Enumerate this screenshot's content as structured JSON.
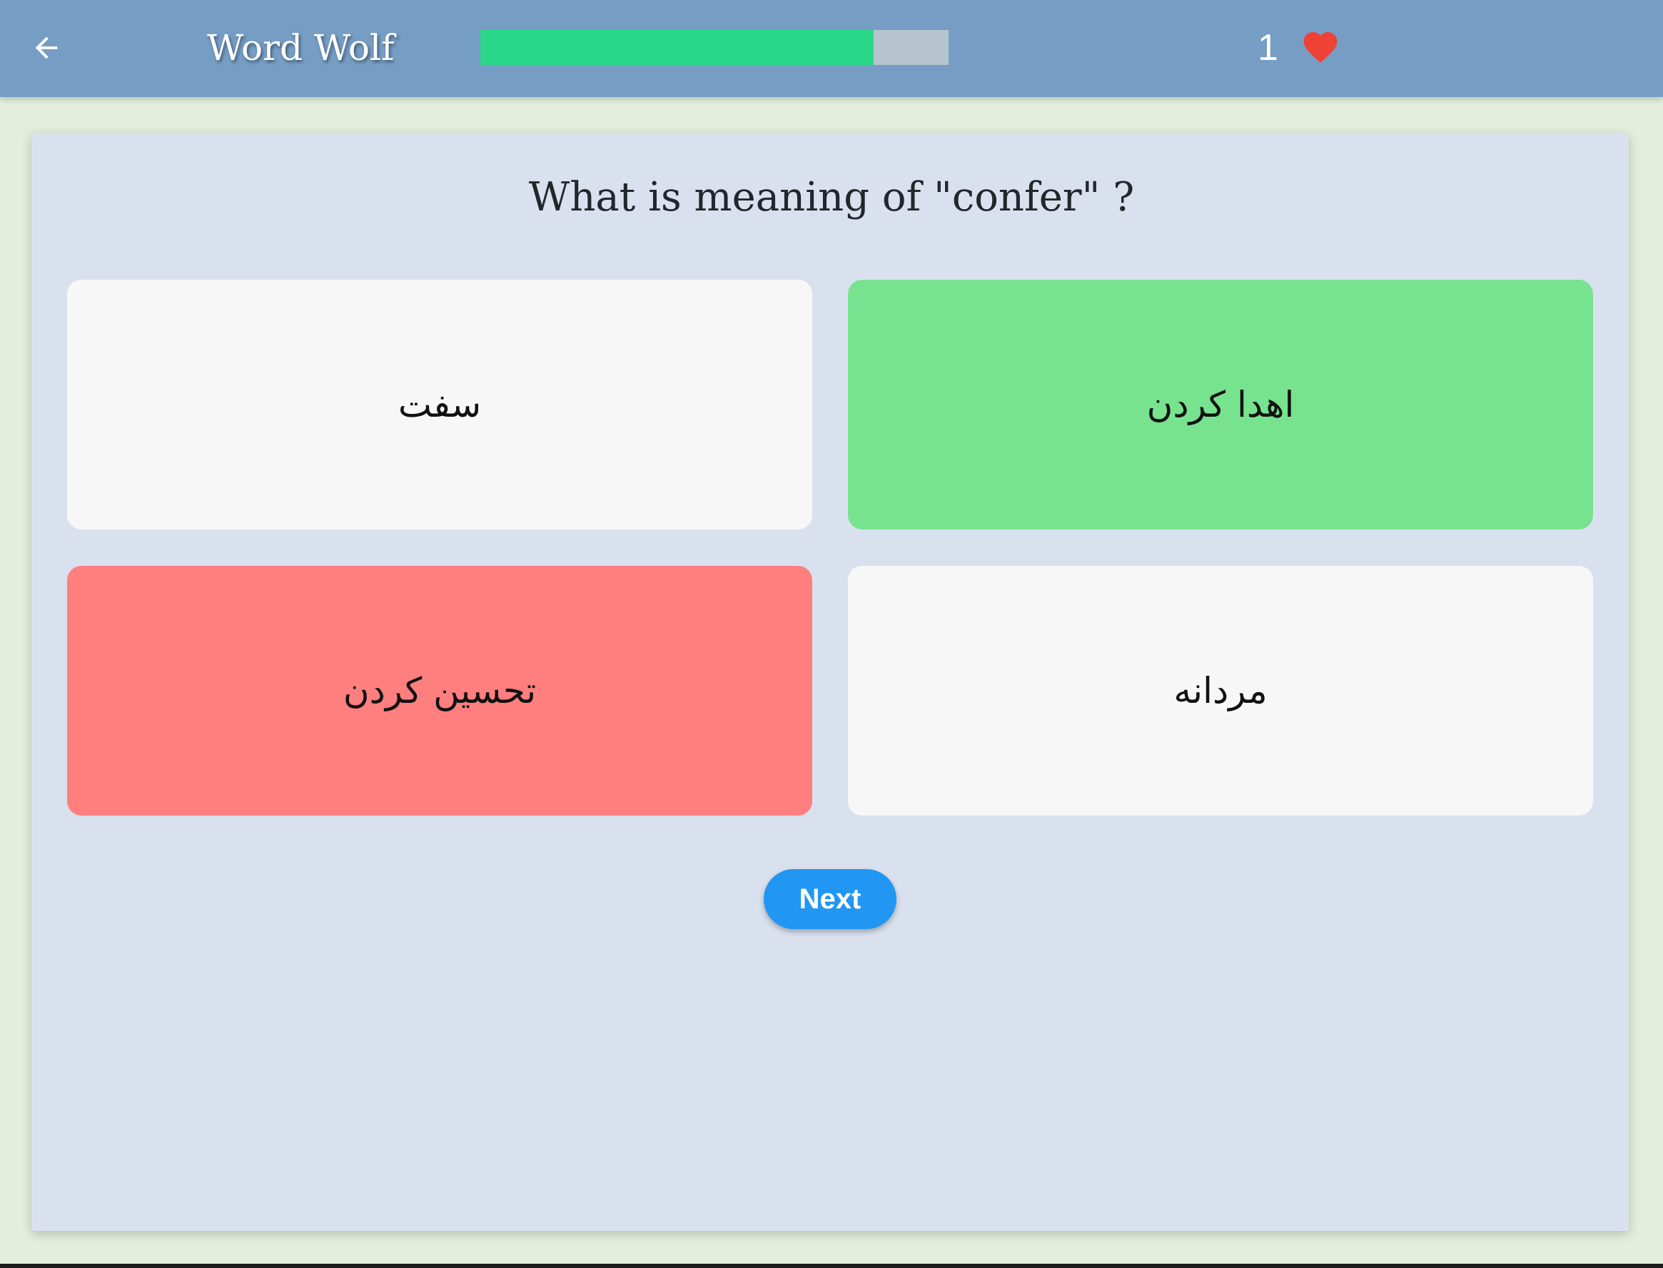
{
  "app": {
    "title": "Word Wolf",
    "back_icon": "arrow-left-icon"
  },
  "progress": {
    "fraction": 0.84,
    "fill_color": "#2bd88a",
    "track_color": "#b6c5cd"
  },
  "lives": {
    "count": "1",
    "icon": "heart-icon",
    "icon_color": "#ef4135"
  },
  "quiz": {
    "question": "What is meaning of \"confer\" ?",
    "options": [
      {
        "label": "سفت",
        "state": "neutral"
      },
      {
        "label": "اهدا کردن",
        "state": "correct"
      },
      {
        "label": "تحسین کردن",
        "state": "wrong"
      },
      {
        "label": "مردانه",
        "state": "neutral"
      }
    ],
    "next_label": "Next"
  },
  "colors": {
    "app_bar": "#769dc4",
    "page_background": "#e3efdc",
    "card_background": "#dae1ee",
    "option_neutral": "#f8f7f8",
    "option_correct": "#77e38f",
    "option_wrong": "#ff7f7e",
    "next_button": "#2196f3"
  }
}
